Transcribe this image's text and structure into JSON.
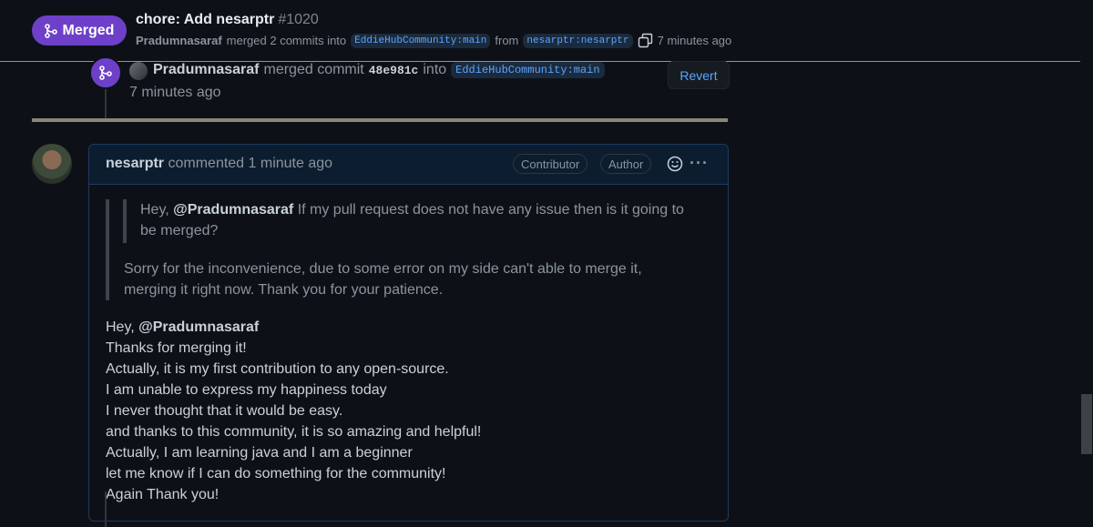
{
  "header": {
    "state_label": "Merged",
    "title": "chore: Add nesarptr",
    "number": "#1020",
    "author": "Pradumnasaraf",
    "merged_text": "merged 2 commits into",
    "base_branch": "EddieHubCommunity:main",
    "from_text": "from",
    "head_branch": "nesarptr:nesarptr",
    "time": "7 minutes ago"
  },
  "merge_event": {
    "actor": "Pradumnasaraf",
    "action": "merged commit",
    "sha": "48e981c",
    "into_text": "into",
    "branch": "EddieHubCommunity:main",
    "time": "7 minutes ago",
    "revert_label": "Revert"
  },
  "comment": {
    "author": "nesarptr",
    "action": "commented 1 minute ago",
    "badges": [
      "Contributor",
      "Author"
    ],
    "more_label": "···",
    "nested_quote": {
      "prefix": "Hey, ",
      "mention": "@Pradumnasaraf",
      "text": " If my pull request does not have any issue then is it going to be merged?"
    },
    "quote_reply": "Sorry for the inconvenience, due to some error on my side can't able to merge it, merging it right now. Thank you for your patience.",
    "greeting_prefix": "Hey, ",
    "greeting_mention": "@Pradumnasaraf",
    "lines": [
      "Thanks for merging it!",
      "Actually, it is my first contribution to any open-source.",
      "I am unable to express my happiness today",
      "I never thought that it would be easy.",
      "and thanks to this community, it is so amazing and helpful!",
      "Actually, I am learning java and I am a beginner",
      "let me know if I can do something for the community!",
      "Again Thank you!"
    ]
  },
  "colors": {
    "background": "#0d1117",
    "merged_purple": "#6e40c9",
    "link_blue": "#58a6ff",
    "muted_text": "#8b949e"
  },
  "icons": {
    "merge": "git-merge-icon",
    "copy": "copy-icon",
    "reaction": "smiley-icon",
    "more": "kebab-icon"
  }
}
